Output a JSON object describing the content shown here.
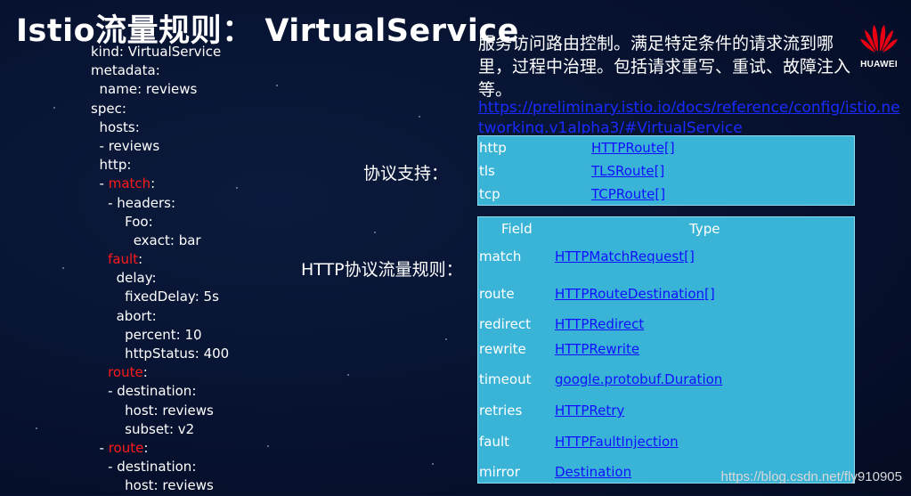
{
  "title": "Istio流量规则： VirtualService",
  "yaml_lines": [
    {
      "indent": 0,
      "key": "kind",
      "sep": ": ",
      "value": "VirtualService"
    },
    {
      "indent": 0,
      "key": "metadata",
      "sep": ":",
      "value": ""
    },
    {
      "indent": 1,
      "key": "name",
      "sep": ": ",
      "value": "reviews"
    },
    {
      "indent": 0,
      "key": "spec",
      "sep": ":",
      "value": ""
    },
    {
      "indent": 1,
      "key": "hosts",
      "sep": ":",
      "value": ""
    },
    {
      "indent": 1,
      "prefix": "- ",
      "key": "reviews",
      "sep": "",
      "value": ""
    },
    {
      "indent": 1,
      "key": "http",
      "sep": ":",
      "value": ""
    },
    {
      "indent": 1,
      "prefix": "- ",
      "key": "match",
      "sep": ":",
      "value": "",
      "highlight": true
    },
    {
      "indent": 2,
      "prefix": "- ",
      "key": "headers",
      "sep": ":",
      "value": ""
    },
    {
      "indent": 4,
      "key": "Foo",
      "sep": ":",
      "value": ""
    },
    {
      "indent": 5,
      "key": "exact",
      "sep": ": ",
      "value": "bar"
    },
    {
      "indent": 2,
      "key": "fault",
      "sep": ":",
      "value": "",
      "highlight": true
    },
    {
      "indent": 3,
      "key": "delay",
      "sep": ":",
      "value": ""
    },
    {
      "indent": 4,
      "key": "fixedDelay",
      "sep": ": ",
      "value": "5s"
    },
    {
      "indent": 3,
      "key": "abort",
      "sep": ":",
      "value": ""
    },
    {
      "indent": 4,
      "key": "percent",
      "sep": ": ",
      "value": "10"
    },
    {
      "indent": 4,
      "key": "httpStatus",
      "sep": ": ",
      "value": "400"
    },
    {
      "indent": 2,
      "key": "route",
      "sep": ":",
      "value": "",
      "highlight": true
    },
    {
      "indent": 2,
      "prefix": "- ",
      "key": "destination",
      "sep": ":",
      "value": ""
    },
    {
      "indent": 4,
      "key": "host",
      "sep": ": ",
      "value": "reviews"
    },
    {
      "indent": 4,
      "key": "subset",
      "sep": ": ",
      "value": "v2"
    },
    {
      "indent": 1,
      "prefix": "- ",
      "key": "route",
      "sep": ":",
      "value": "",
      "highlight": true
    },
    {
      "indent": 2,
      "prefix": "- ",
      "key": "destination",
      "sep": ":",
      "value": ""
    },
    {
      "indent": 4,
      "key": "host",
      "sep": ": ",
      "value": "reviews"
    }
  ],
  "description": "服务访问路由控制。满足特定条件的请求流到哪里，过程中治理。包括请求重写、重试、故障注入等。",
  "doc_link": "https://preliminary.istio.io/docs/reference/config/istio.networking.v1alpha3/#VirtualService",
  "logo": {
    "text": "HUAWEI",
    "color": "#e60012"
  },
  "protocol_label": "协议支持：",
  "protocols": [
    {
      "name": "http",
      "type": "HTTPRoute[]"
    },
    {
      "name": "tls",
      "type": "TLSRoute[]"
    },
    {
      "name": "tcp",
      "type": "TCPRoute[]"
    }
  ],
  "http_label": "HTTP协议流量规则：",
  "http_table": {
    "headers": {
      "field": "Field",
      "type": "Type"
    },
    "rows": [
      {
        "field": "match",
        "type": "HTTPMatchRequest[]"
      },
      {
        "field": "route",
        "type": "HTTPRouteDestination[]"
      },
      {
        "field": "redirect",
        "type": "HTTPRedirect"
      },
      {
        "field": "rewrite",
        "type": "HTTPRewrite"
      },
      {
        "field": "timeout",
        "type": "google.protobuf.Duration"
      },
      {
        "field": "retries",
        "type": "HTTPRetry"
      },
      {
        "field": "fault",
        "type": "HTTPFaultInjection"
      },
      {
        "field": "mirror",
        "type": "Destination"
      }
    ]
  },
  "watermark": "https://blog.csdn.net/fly910905",
  "colors": {
    "highlight": "#ff1a1a",
    "link": "#1010ff",
    "panel": "#3ab4d6"
  }
}
